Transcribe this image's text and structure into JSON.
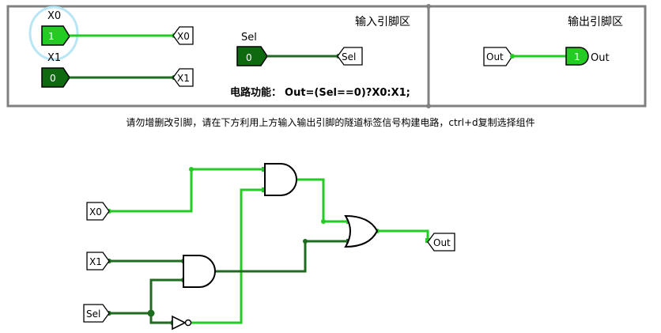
{
  "panels": {
    "input_title": "输入引脚区",
    "output_title": "输出引脚区",
    "function_label": "电路功能：",
    "function_expr": "Out=(Sel==0)?X0:X1;"
  },
  "instruction": "请勿增删改引脚，请在下方利用上方输入输出引脚的隧道标签信号构建电路，ctrl+d复制选择组件",
  "inputs": [
    {
      "name": "X0",
      "value": "1"
    },
    {
      "name": "X1",
      "value": "0"
    },
    {
      "name": "Sel",
      "value": "0"
    }
  ],
  "tunnels": {
    "x0": "X0",
    "x1": "X1",
    "sel": "Sel",
    "out": "Out"
  },
  "output": {
    "tunnel": "Out",
    "value": "1",
    "label": "Out"
  },
  "colors": {
    "wire_high": "#22cc22",
    "wire_low": "#1f6b1f",
    "pin_high": "#22cc22",
    "pin_low": "#0f6a0f",
    "frame": "#808080",
    "selection_ring": "#b8e6f5"
  }
}
